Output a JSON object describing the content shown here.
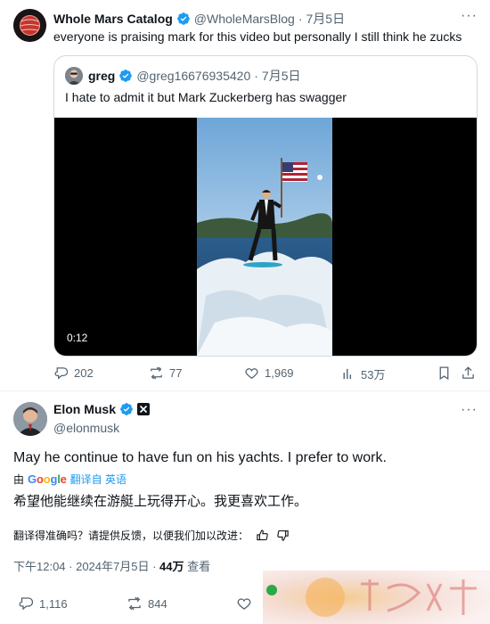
{
  "top_tweet": {
    "display_name": "Whole Mars Catalog",
    "handle": "@WholeMarsBlog",
    "date": "7月5日",
    "text": "everyone is praising mark for this video but personally I still think he zucks",
    "more": "···"
  },
  "quote": {
    "display_name": "greg",
    "handle": "@greg16676935420",
    "date": "7月5日",
    "text": "I hate to admit it but Mark Zuckerberg has swagger",
    "video_time": "0:12"
  },
  "top_actions": {
    "replies": "202",
    "reposts": "77",
    "likes": "1,969",
    "views": "53万"
  },
  "elon_tweet": {
    "display_name": "Elon Musk",
    "handle": "@elonmusk",
    "text": "May he continue to have fun on his yachts. I prefer to work.",
    "translate_by": "由",
    "translate_brand": "Google",
    "translate_from": "翻译自 英语",
    "translated_text": "希望他能继续在游艇上玩得开心。我更喜欢工作。",
    "feedback_text": "翻译得准确吗？请提供反馈，以便我们加以改进：",
    "time": "下午12:04 · 2024年7月5日 · ",
    "views_count": "44万",
    "views_label": "查看",
    "more": "···"
  },
  "bottom_actions": {
    "replies": "1,116",
    "reposts": "844"
  },
  "colors": {
    "accent": "#1d9bf0",
    "muted": "#536471",
    "border": "#cfd9de"
  }
}
